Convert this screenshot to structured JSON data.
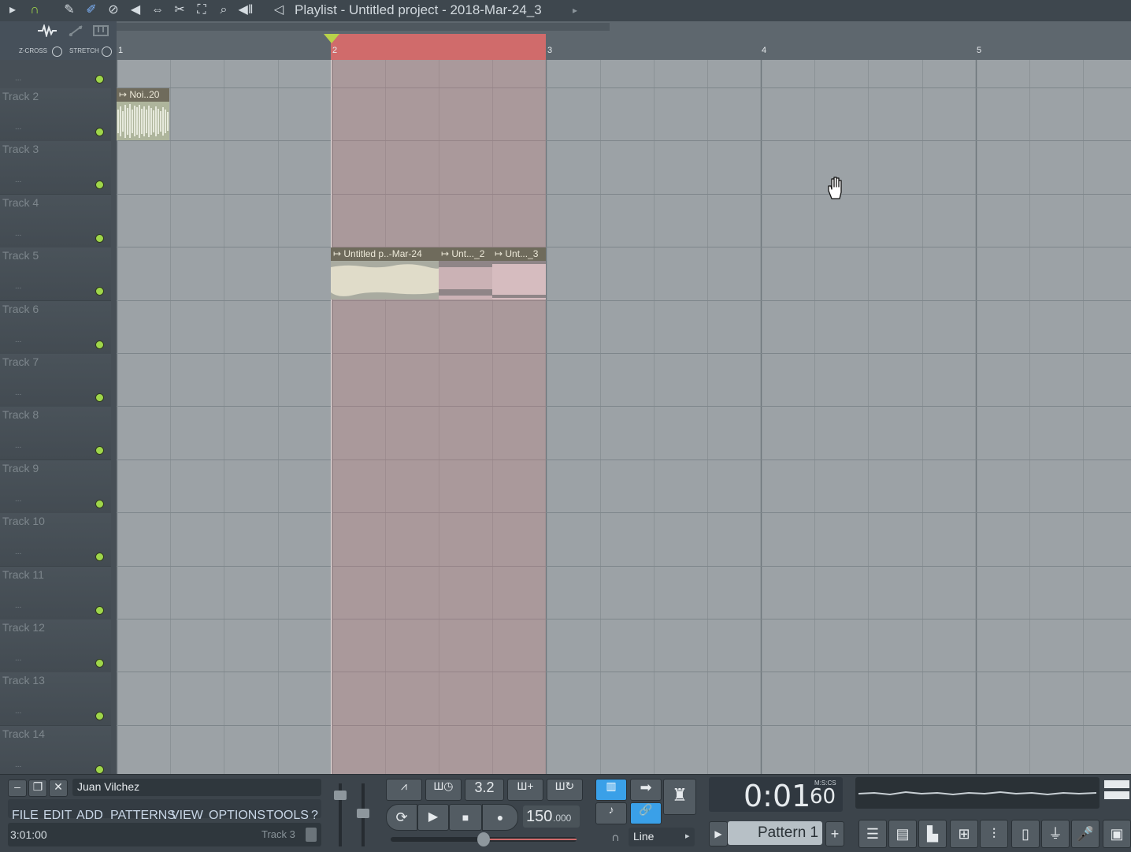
{
  "window": {
    "title": "Playlist - Untitled project - 2018-Mar-24_3"
  },
  "toolbar": {
    "icons": [
      "play-arrow-icon",
      "magnet-icon",
      "pencil-icon",
      "brush-icon",
      "delete-icon",
      "mute-icon",
      "slip-icon",
      "slice-icon",
      "select-icon",
      "zoom-icon",
      "playback-icon",
      "speaker-icon"
    ]
  },
  "options": {
    "zcross_label": "Z-CROSS",
    "stretch_label": "STRETCH"
  },
  "ruler": {
    "bars": [
      "1",
      "2",
      "3",
      "4",
      "5"
    ]
  },
  "tracks": [
    {
      "label": "Track 2"
    },
    {
      "label": "Track 3"
    },
    {
      "label": "Track 4"
    },
    {
      "label": "Track 5"
    },
    {
      "label": "Track 6"
    },
    {
      "label": "Track 7"
    },
    {
      "label": "Track 8"
    },
    {
      "label": "Track 9"
    },
    {
      "label": "Track 10"
    },
    {
      "label": "Track 11"
    },
    {
      "label": "Track 12"
    },
    {
      "label": "Track 13"
    },
    {
      "label": "Track 14"
    }
  ],
  "track_dots": "...",
  "clips": [
    {
      "label": "Noi..20"
    },
    {
      "label": "Untitled p..-Mar-24"
    },
    {
      "label": "Unt..._2"
    },
    {
      "label": "Unt..._3"
    }
  ],
  "bottom": {
    "user": "Juan Vilchez",
    "menu": [
      "FILE",
      "EDIT",
      "ADD",
      "PATTERNS",
      "VIEW",
      "OPTIONS",
      "TOOLS",
      "?"
    ],
    "hint_time": "3:01:00",
    "hint_track": "Track 3",
    "pattern_step": "3.2",
    "tempo": "150",
    "tempo_dec": ".000",
    "time_main": "0:01",
    "time_cs": "60",
    "time_format": "M:S:CS",
    "snap": "Line",
    "pattern": "Pattern 1",
    "add_pattern": "+"
  },
  "colors": {
    "loop_selection": "#d06b6b",
    "led": "#9fd64a",
    "grid": "#9ca2a6"
  }
}
